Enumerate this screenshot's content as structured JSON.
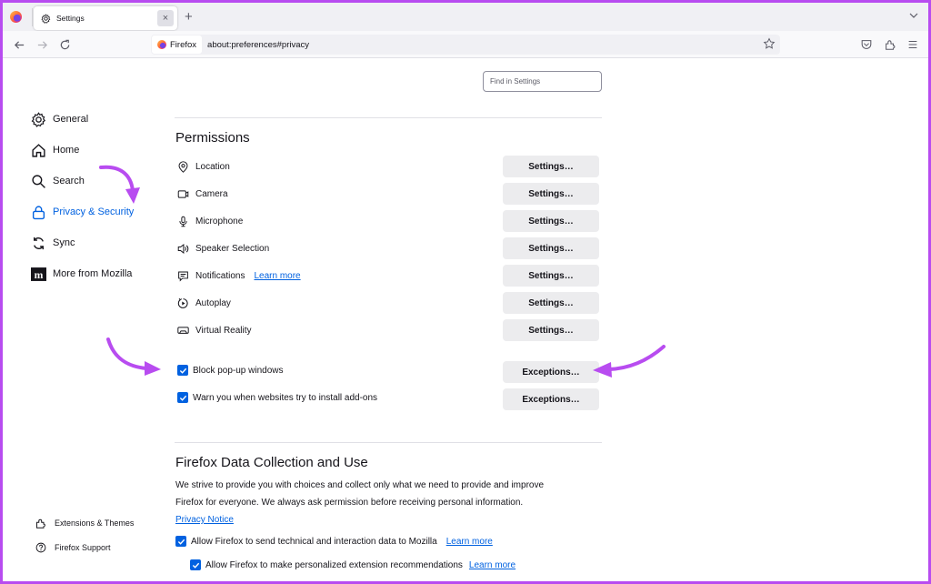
{
  "browser": {
    "tab_title": "Settings",
    "new_tab_label": "+",
    "close_tab_label": "×",
    "identity_label": "Firefox",
    "url": "about:preferences#privacy"
  },
  "search": {
    "placeholder": "Find in Settings"
  },
  "sidebar": {
    "items": [
      {
        "label": "General",
        "icon": "gear-icon",
        "active": false
      },
      {
        "label": "Home",
        "icon": "home-icon",
        "active": false
      },
      {
        "label": "Search",
        "icon": "search-icon",
        "active": false
      },
      {
        "label": "Privacy & Security",
        "icon": "lock-icon",
        "active": true
      },
      {
        "label": "Sync",
        "icon": "sync-icon",
        "active": false
      },
      {
        "label": "More from Mozilla",
        "icon": "mozilla-icon",
        "active": false
      }
    ],
    "footer": [
      {
        "label": "Extensions & Themes",
        "icon": "puzzle-icon"
      },
      {
        "label": "Firefox Support",
        "icon": "help-icon"
      }
    ]
  },
  "permissions": {
    "title": "Permissions",
    "rows": [
      {
        "label": "Location",
        "icon": "location-icon",
        "button": "Settings…"
      },
      {
        "label": "Camera",
        "icon": "camera-icon",
        "button": "Settings…"
      },
      {
        "label": "Microphone",
        "icon": "microphone-icon",
        "button": "Settings…"
      },
      {
        "label": "Speaker Selection",
        "icon": "speaker-icon",
        "button": "Settings…"
      },
      {
        "label": "Notifications",
        "icon": "notification-icon",
        "button": "Settings…",
        "link": "Learn more"
      },
      {
        "label": "Autoplay",
        "icon": "autoplay-icon",
        "button": "Settings…"
      },
      {
        "label": "Virtual Reality",
        "icon": "vr-icon",
        "button": "Settings…"
      }
    ],
    "checks": [
      {
        "label": "Block pop-up windows",
        "checked": true,
        "button": "Exceptions…"
      },
      {
        "label": "Warn you when websites try to install add-ons",
        "checked": true,
        "button": "Exceptions…"
      }
    ]
  },
  "data_collection": {
    "title": "Firefox Data Collection and Use",
    "paragraph_line1": "We strive to provide you with choices and collect only what we need to provide and improve",
    "paragraph_line2": "Firefox for everyone. We always ask permission before receiving personal information.",
    "privacy_link": "Privacy Notice",
    "checks": [
      {
        "label": "Allow Firefox to send technical and interaction data to Mozilla",
        "checked": true,
        "link": "Learn more"
      },
      {
        "label": "Allow Firefox to make personalized extension recommendations",
        "checked": true,
        "link": "Learn more"
      }
    ]
  },
  "colors": {
    "accent": "#0061e0",
    "annotation_arrow": "#b84cf0",
    "frame": "#b84cf0"
  }
}
